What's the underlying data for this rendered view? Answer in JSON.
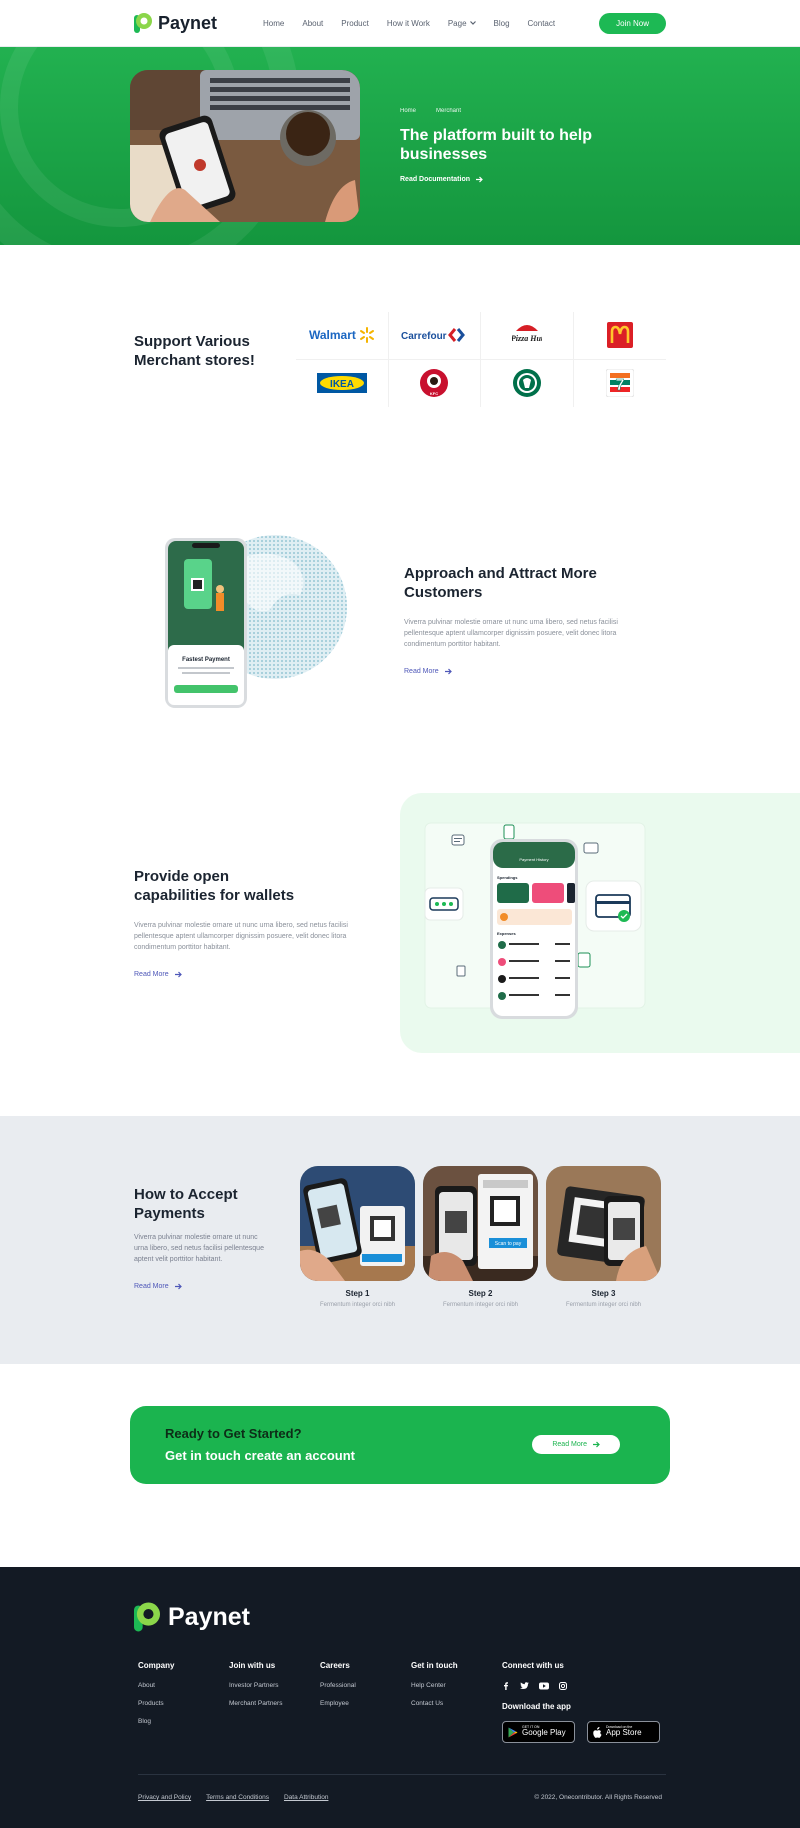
{
  "brand": {
    "name": "Paynet",
    "green": "#1db954",
    "dark": "#131a24",
    "accent_link": "#4e57b8"
  },
  "nav": {
    "items": [
      "Home",
      "About",
      "Product",
      "How it Work",
      "Page",
      "Blog",
      "Contact"
    ],
    "join_label": "Join Now"
  },
  "hero": {
    "breadcrumb": [
      "Home",
      "Merchant"
    ],
    "title": "The platform built to help businesses",
    "link": "Read Documentation"
  },
  "merchants": {
    "title": "Support Various Merchant stores!",
    "logos": [
      "Walmart",
      "Carrefour",
      "Pizza Hut",
      "McDonald's",
      "IKEA",
      "KFC",
      "Starbucks",
      "7-Eleven"
    ]
  },
  "approach": {
    "title": "Approach and Attract More Customers",
    "desc": "Viverra pulvinar molestie ornare ut nunc urna libero, sed netus facilisi pellentesque aptent ullamcorper dignissim posuere, velit donec litora condimentum porttitor habitant.",
    "link": "Read More",
    "phone_card_title": "Fastest Payment"
  },
  "wallet": {
    "title": "Provide open capabilities for wallets",
    "desc": "Viverra pulvinar molestie ornare ut nunc urna libero, sed netus facilisi pellentesque aptent ullamcorper dignissim posuere, velit donec litora condimentum porttitor habitant.",
    "link": "Read More",
    "phone_header": "Payment History",
    "phone_spendings": "Spendings",
    "phone_expenses": "Expenses"
  },
  "how": {
    "title": "How to Accept Payments",
    "desc": "Viverra pulvinar molestie ornare ut nunc urna libero, sed netus facilisi pellentesque aptent velit porttitor habitant.",
    "link": "Read More",
    "steps": [
      {
        "title": "Step 1",
        "sub": "Fermentum integer orci nibh"
      },
      {
        "title": "Step 2",
        "sub": "Fermentum integer orci nibh"
      },
      {
        "title": "Step 3",
        "sub": "Fermentum integer orci nibh"
      }
    ],
    "qr_label": "Scan to pay"
  },
  "cta": {
    "line1": "Ready to Get Started?",
    "line2": "Get in touch create an account",
    "button": "Read More"
  },
  "footer": {
    "columns": [
      {
        "title": "Company",
        "links": [
          "About",
          "Products",
          "Blog"
        ]
      },
      {
        "title": "Join with us",
        "links": [
          "Investor Partners",
          "Merchant Partners"
        ]
      },
      {
        "title": "Careers",
        "links": [
          "Professional",
          "Employee"
        ]
      },
      {
        "title": "Get in touch",
        "links": [
          "Help Center",
          "Contact Us"
        ]
      }
    ],
    "connect_title": "Connect with us",
    "download_title": "Download the app",
    "google_small": "GET IT ON",
    "google_big": "Google Play",
    "apple_small": "Download on the",
    "apple_big": "App Store",
    "legal": [
      "Privacy and Policy",
      "Terms and Conditions",
      "Data Attribution"
    ],
    "copyright": "© 2022, Onecontributor. All Rights Reserved"
  }
}
